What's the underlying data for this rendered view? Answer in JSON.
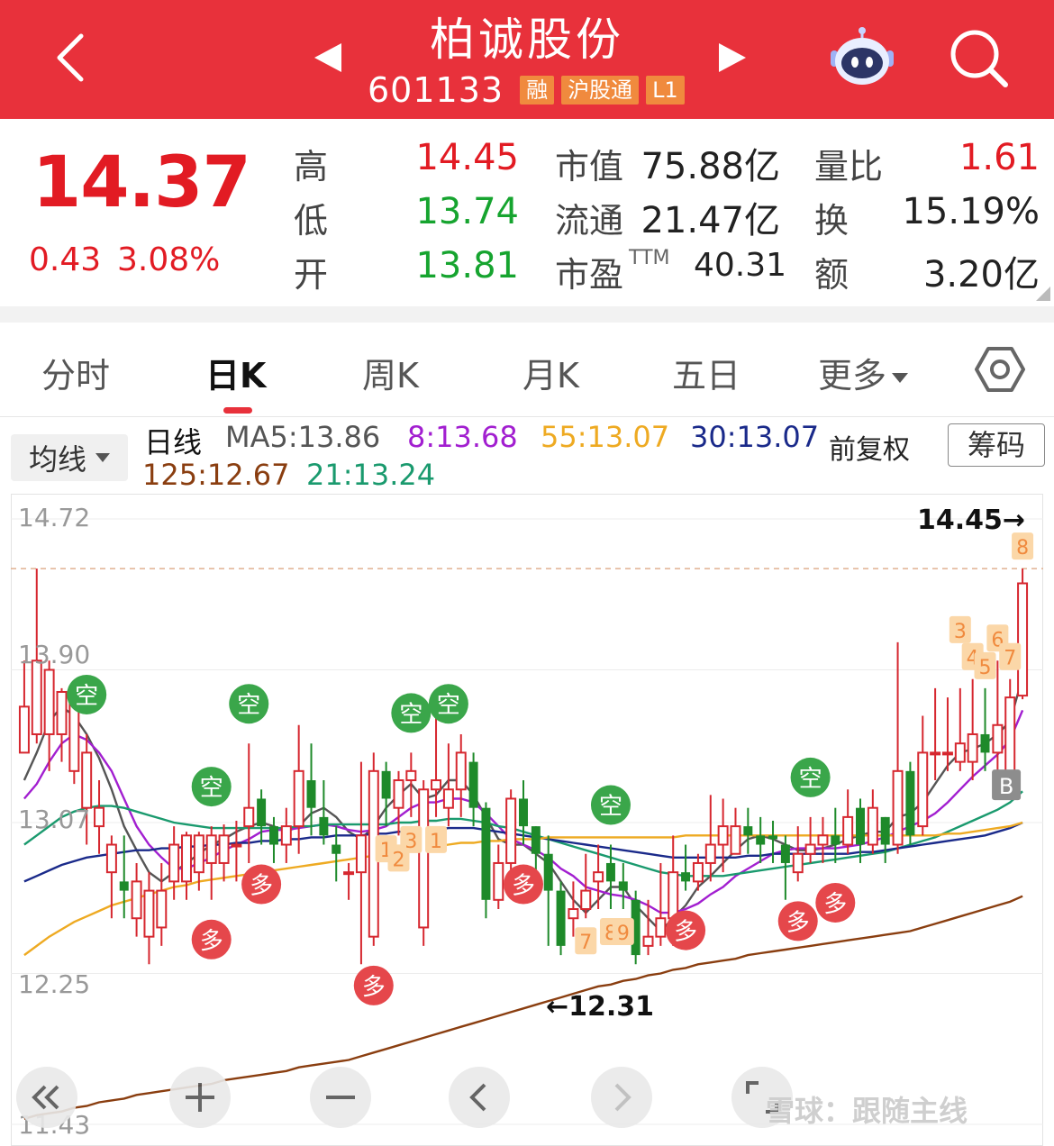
{
  "header": {
    "title": "柏诚股份",
    "code": "601133",
    "tags": [
      "融",
      "沪股通",
      "L1"
    ]
  },
  "quote": {
    "price": "14.37",
    "change": "0.43",
    "change_pct": "3.08%",
    "high_label": "高",
    "high": "14.45",
    "low_label": "低",
    "low": "13.74",
    "open_label": "开",
    "open": "13.81",
    "mcap_label": "市值",
    "mcap": "75.88亿",
    "float_label": "流通",
    "float": "21.47亿",
    "pe_label": "市盈",
    "pe_sup": "TTM",
    "pe": "40.31",
    "vr_label": "量比",
    "vr": "1.61",
    "turnover_label": "换",
    "turnover": "15.19%",
    "amount_label": "额",
    "amount": "3.20亿"
  },
  "tabs": [
    "分时",
    "日K",
    "周K",
    "月K",
    "五日",
    "更多"
  ],
  "active_tab": "日K",
  "legend": {
    "ma_button": "均线",
    "period": "日线",
    "ma5": "MA5:13.86",
    "ma8": "8:13.68",
    "ma55": "55:13.07",
    "ma30": "30:13.07",
    "ma125": "125:12.67",
    "ma21": "21:13.24",
    "adjust": "前复权",
    "chips_button": "筹码"
  },
  "colors": {
    "header": "#e8313b",
    "up": "#d6272f",
    "down": "#1e8a2a",
    "ma5": "#555555",
    "ma8": "#a21fd0",
    "ma55": "#eeaa22",
    "ma30": "#1a2a8a",
    "ma125": "#8a3e10",
    "ma21": "#1a9a6e"
  },
  "chart_data": {
    "type": "candlestick",
    "y_ticks": [
      "14.72",
      "13.90",
      "13.07",
      "12.25",
      "11.43"
    ],
    "ylim": [
      11.43,
      14.72
    ],
    "high_annotation": "14.45→",
    "low_annotation": "←12.31",
    "high_value": 14.45,
    "low_value": 12.31,
    "candles": [
      [
        13.45,
        13.7,
        13.95,
        13.5
      ],
      [
        13.55,
        13.95,
        14.45,
        13.5
      ],
      [
        13.55,
        13.9,
        13.95,
        13.35
      ],
      [
        13.55,
        13.78,
        13.8,
        13.4
      ],
      [
        13.35,
        13.72,
        13.8,
        13.28
      ],
      [
        13.15,
        13.45,
        13.55,
        12.95
      ],
      [
        13.05,
        13.15,
        13.3,
        12.9
      ],
      [
        12.8,
        12.95,
        13.0,
        12.55
      ],
      [
        12.75,
        12.7,
        13.0,
        12.55
      ],
      [
        12.55,
        12.75,
        12.85,
        12.45
      ],
      [
        12.45,
        12.7,
        12.8,
        12.3
      ],
      [
        12.5,
        12.7,
        12.85,
        12.4
      ],
      [
        12.75,
        12.95,
        13.05,
        12.65
      ],
      [
        12.75,
        13.0,
        13.02,
        12.65
      ],
      [
        12.8,
        13.0,
        13.02,
        12.7
      ],
      [
        12.85,
        13.0,
        13.05,
        12.65
      ],
      [
        12.85,
        13.0,
        13.06,
        12.75
      ],
      [
        12.95,
        12.95,
        13.08,
        12.75
      ],
      [
        13.05,
        13.15,
        13.5,
        12.85
      ],
      [
        13.2,
        13.05,
        13.25,
        12.95
      ],
      [
        13.05,
        12.95,
        13.1,
        12.85
      ],
      [
        12.95,
        13.05,
        13.15,
        12.85
      ],
      [
        13.05,
        13.35,
        13.6,
        12.9
      ],
      [
        13.3,
        13.15,
        13.5,
        13.0
      ],
      [
        13.1,
        13.0,
        13.3,
        12.95
      ],
      [
        12.95,
        12.9,
        13.05,
        12.75
      ],
      [
        12.8,
        12.8,
        12.85,
        12.65
      ],
      [
        12.8,
        13.0,
        13.4,
        12.3
      ],
      [
        12.45,
        13.35,
        13.45,
        12.4
      ],
      [
        13.35,
        13.2,
        13.4,
        13.05
      ],
      [
        13.15,
        13.3,
        13.35,
        13.0
      ],
      [
        13.3,
        13.35,
        13.45,
        13.1
      ],
      [
        12.5,
        13.25,
        13.3,
        12.4
      ],
      [
        13.25,
        13.3,
        13.75,
        13.1
      ],
      [
        13.15,
        13.25,
        13.5,
        13.05
      ],
      [
        13.25,
        13.45,
        13.55,
        13.1
      ],
      [
        13.4,
        13.15,
        13.45,
        13.05
      ],
      [
        13.15,
        12.65,
        13.18,
        12.55
      ],
      [
        12.65,
        12.85,
        12.95,
        12.6
      ],
      [
        12.85,
        13.2,
        13.25,
        12.8
      ],
      [
        13.2,
        13.05,
        13.3,
        12.95
      ],
      [
        13.05,
        12.9,
        13.05,
        12.8
      ],
      [
        12.9,
        12.7,
        13.0,
        12.4
      ],
      [
        12.7,
        12.4,
        12.75,
        12.35
      ],
      [
        12.55,
        12.6,
        12.75,
        12.45
      ],
      [
        12.6,
        12.7,
        12.9,
        12.55
      ],
      [
        12.75,
        12.8,
        12.95,
        12.6
      ],
      [
        12.85,
        12.75,
        12.95,
        12.6
      ],
      [
        12.75,
        12.7,
        12.85,
        12.6
      ],
      [
        12.65,
        12.35,
        12.7,
        12.3
      ],
      [
        12.4,
        12.45,
        12.65,
        12.35
      ],
      [
        12.45,
        12.55,
        12.85,
        12.4
      ],
      [
        12.55,
        12.8,
        13.0,
        12.4
      ],
      [
        12.8,
        12.75,
        12.95,
        12.7
      ],
      [
        12.75,
        12.85,
        12.9,
        12.7
      ],
      [
        12.85,
        12.95,
        13.22,
        12.75
      ],
      [
        12.95,
        13.05,
        13.2,
        12.8
      ],
      [
        12.9,
        13.05,
        13.15,
        12.9
      ],
      [
        13.05,
        13.0,
        13.15,
        12.9
      ],
      [
        13.0,
        12.95,
        13.1,
        12.85
      ],
      [
        13.0,
        12.98,
        13.08,
        12.85
      ],
      [
        12.95,
        12.85,
        13.0,
        12.65
      ],
      [
        12.8,
        12.9,
        13.05,
        12.75
      ],
      [
        12.9,
        12.95,
        13.1,
        12.85
      ],
      [
        12.95,
        13.0,
        13.1,
        12.85
      ],
      [
        13.0,
        12.95,
        13.15,
        12.85
      ],
      [
        12.95,
        13.1,
        13.25,
        12.9
      ],
      [
        13.15,
        12.95,
        13.2,
        12.85
      ],
      [
        12.95,
        13.15,
        13.25,
        12.9
      ],
      [
        13.1,
        12.95,
        13.1,
        12.85
      ],
      [
        12.95,
        13.35,
        14.05,
        12.9
      ],
      [
        13.35,
        13.0,
        13.4,
        12.95
      ],
      [
        13.05,
        13.45,
        13.65,
        13.0
      ],
      [
        13.45,
        13.45,
        13.8,
        13.3
      ],
      [
        13.45,
        13.45,
        13.75,
        13.35
      ],
      [
        13.4,
        13.5,
        13.8,
        13.35
      ],
      [
        13.4,
        13.55,
        13.85,
        13.3
      ],
      [
        13.55,
        13.45,
        13.8,
        13.35
      ],
      [
        13.45,
        13.6,
        13.95,
        13.3
      ],
      [
        13.35,
        13.75,
        13.85,
        13.35
      ],
      [
        13.76,
        14.37,
        14.45,
        13.74
      ]
    ],
    "ma_lines": [
      {
        "name": "MA5",
        "last": 13.86,
        "values": [
          13.3,
          13.45,
          13.62,
          13.7,
          13.65,
          13.55,
          13.42,
          13.25,
          13.05,
          12.92,
          12.8,
          12.75,
          12.8,
          12.85,
          12.9,
          12.95,
          12.98,
          13.02,
          13.05,
          13.07,
          13.05,
          13.02,
          13.05,
          13.12,
          13.15,
          13.1,
          13.02,
          12.98,
          13.05,
          13.15,
          13.22,
          13.28,
          13.2,
          13.22,
          13.3,
          13.3,
          13.22,
          13.1,
          12.98,
          12.95,
          12.95,
          12.9,
          12.85,
          12.75,
          12.65,
          12.58,
          12.65,
          12.72,
          12.72,
          12.62,
          12.55,
          12.48,
          12.55,
          12.62,
          12.72,
          12.78,
          12.85,
          12.92,
          12.98,
          13.0,
          12.98,
          12.95,
          12.92,
          12.92,
          12.93,
          12.95,
          12.98,
          13.0,
          13.02,
          13.02,
          13.1,
          13.12,
          13.18,
          13.28,
          13.38,
          13.45,
          13.47,
          13.5,
          13.55,
          13.62,
          13.86
        ]
      },
      {
        "name": "MA8",
        "last": 13.68,
        "values": [
          13.2,
          13.28,
          13.4,
          13.5,
          13.55,
          13.52,
          13.45,
          13.35,
          13.2,
          13.05,
          12.95,
          12.88,
          12.82,
          12.82,
          12.85,
          12.88,
          12.92,
          12.95,
          12.98,
          13.02,
          13.03,
          13.03,
          13.04,
          13.05,
          13.06,
          13.05,
          13.03,
          13.02,
          13.03,
          13.05,
          13.1,
          13.15,
          13.18,
          13.18,
          13.2,
          13.2,
          13.18,
          13.12,
          13.05,
          12.98,
          12.95,
          12.92,
          12.88,
          12.82,
          12.78,
          12.72,
          12.7,
          12.68,
          12.67,
          12.65,
          12.62,
          12.58,
          12.58,
          12.6,
          12.63,
          12.68,
          12.72,
          12.78,
          12.82,
          12.86,
          12.9,
          12.92,
          12.93,
          12.93,
          12.93,
          12.93,
          12.94,
          12.95,
          12.97,
          12.99,
          13.02,
          13.05,
          13.08,
          13.12,
          13.18,
          13.25,
          13.32,
          13.38,
          13.44,
          13.52,
          13.68
        ]
      },
      {
        "name": "MA21",
        "last": 13.24,
        "values": [
          12.95,
          13.0,
          13.05,
          13.1,
          13.13,
          13.15,
          13.16,
          13.16,
          13.15,
          13.13,
          13.11,
          13.09,
          13.07,
          13.06,
          13.05,
          13.04,
          13.04,
          13.04,
          13.04,
          13.04,
          13.04,
          13.04,
          13.05,
          13.05,
          13.06,
          13.06,
          13.06,
          13.06,
          13.06,
          13.06,
          13.07,
          13.07,
          13.08,
          13.08,
          13.09,
          13.09,
          13.08,
          13.07,
          13.05,
          13.04,
          13.02,
          13.0,
          12.98,
          12.96,
          12.94,
          12.92,
          12.9,
          12.88,
          12.86,
          12.84,
          12.82,
          12.8,
          12.79,
          12.78,
          12.78,
          12.78,
          12.78,
          12.79,
          12.8,
          12.81,
          12.82,
          12.83,
          12.84,
          12.85,
          12.86,
          12.87,
          12.88,
          12.89,
          12.9,
          12.91,
          12.93,
          12.95,
          12.97,
          12.99,
          13.02,
          13.05,
          13.08,
          13.11,
          13.14,
          13.18,
          13.24
        ]
      },
      {
        "name": "MA30",
        "last": 13.07,
        "values": [
          12.75,
          12.78,
          12.81,
          12.84,
          12.86,
          12.88,
          12.89,
          12.9,
          12.91,
          12.92,
          12.92,
          12.93,
          12.93,
          12.94,
          12.94,
          12.95,
          12.95,
          12.96,
          12.96,
          12.97,
          12.97,
          12.98,
          12.98,
          12.99,
          12.99,
          13.0,
          13.0,
          13.0,
          13.01,
          13.01,
          13.02,
          13.02,
          13.03,
          13.03,
          13.04,
          13.04,
          13.04,
          13.03,
          13.02,
          13.01,
          13.0,
          12.99,
          12.98,
          12.97,
          12.96,
          12.95,
          12.94,
          12.93,
          12.92,
          12.91,
          12.9,
          12.89,
          12.88,
          12.88,
          12.88,
          12.88,
          12.88,
          12.88,
          12.89,
          12.89,
          12.9,
          12.9,
          12.9,
          12.9,
          12.9,
          12.9,
          12.9,
          12.91,
          12.91,
          12.92,
          12.93,
          12.94,
          12.95,
          12.96,
          12.97,
          12.98,
          12.99,
          13.0,
          13.02,
          13.04,
          13.07
        ]
      },
      {
        "name": "MA55",
        "last": 13.07,
        "values": [
          12.35,
          12.4,
          12.45,
          12.49,
          12.53,
          12.56,
          12.59,
          12.62,
          12.64,
          12.66,
          12.68,
          12.7,
          12.72,
          12.73,
          12.75,
          12.76,
          12.77,
          12.78,
          12.79,
          12.8,
          12.81,
          12.82,
          12.83,
          12.84,
          12.85,
          12.86,
          12.87,
          12.88,
          12.89,
          12.9,
          12.91,
          12.92,
          12.93,
          12.94,
          12.95,
          12.96,
          12.96,
          12.97,
          12.97,
          12.98,
          12.98,
          12.98,
          12.99,
          12.99,
          12.99,
          12.99,
          12.99,
          12.99,
          12.99,
          12.99,
          12.99,
          12.99,
          12.99,
          13.0,
          13.0,
          13.0,
          13.0,
          13.0,
          13.0,
          13.0,
          13.0,
          13.0,
          13.0,
          13.0,
          13.0,
          13.0,
          13.0,
          13.0,
          13.0,
          13.0,
          13.0,
          13.0,
          13.0,
          13.0,
          13.01,
          13.01,
          13.02,
          13.03,
          13.04,
          13.05,
          13.07
        ]
      },
      {
        "name": "MA125",
        "last": 12.67,
        "values": [
          11.46,
          11.48,
          11.49,
          11.5,
          11.52,
          11.53,
          11.55,
          11.56,
          11.57,
          11.59,
          11.6,
          11.61,
          11.62,
          11.63,
          11.64,
          11.65,
          11.67,
          11.68,
          11.69,
          11.7,
          11.71,
          11.72,
          11.74,
          11.75,
          11.76,
          11.77,
          11.78,
          11.8,
          11.82,
          11.84,
          11.86,
          11.88,
          11.9,
          11.92,
          11.94,
          11.96,
          11.98,
          12.0,
          12.02,
          12.04,
          12.06,
          12.08,
          12.1,
          12.12,
          12.14,
          12.16,
          12.18,
          12.19,
          12.21,
          12.22,
          12.24,
          12.25,
          12.27,
          12.28,
          12.3,
          12.31,
          12.32,
          12.33,
          12.35,
          12.36,
          12.37,
          12.38,
          12.39,
          12.4,
          12.41,
          12.42,
          12.43,
          12.44,
          12.45,
          12.46,
          12.47,
          12.48,
          12.5,
          12.52,
          12.54,
          12.56,
          12.58,
          12.6,
          12.62,
          12.64,
          12.67
        ]
      }
    ],
    "signals_short": [
      {
        "label": "空",
        "index": 5
      },
      {
        "label": "空",
        "index": 15
      },
      {
        "label": "空",
        "index": 18
      },
      {
        "label": "空",
        "index": 31
      },
      {
        "label": "空",
        "index": 34
      },
      {
        "label": "空",
        "index": 47
      },
      {
        "label": "空",
        "index": 63
      }
    ],
    "signals_long": [
      {
        "label": "多",
        "index": 15
      },
      {
        "label": "多",
        "index": 19
      },
      {
        "label": "多",
        "index": 28
      },
      {
        "label": "多",
        "index": 40
      },
      {
        "label": "多",
        "index": 53
      },
      {
        "label": "多",
        "index": 65
      },
      {
        "label": "多",
        "index": 62
      }
    ],
    "count_labels": [
      "1",
      "2",
      "3",
      "7",
      "8",
      "9",
      "1",
      "3",
      "4",
      "5",
      "6",
      "7",
      "8"
    ],
    "b_marker": "B"
  },
  "watermark": "雪球：跟随主线"
}
